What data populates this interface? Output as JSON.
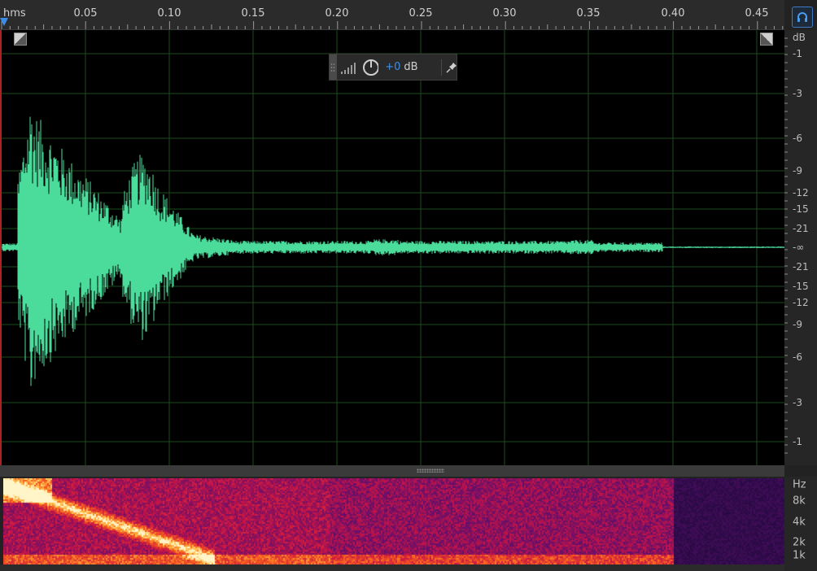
{
  "ruler": {
    "units": "hms",
    "labels": [
      "0.05",
      "0.10",
      "0.15",
      "0.20",
      "0.25",
      "0.30",
      "0.35",
      "0.40",
      "0.45"
    ]
  },
  "hud": {
    "gain_value": "+0",
    "gain_unit": "dB",
    "icons": [
      "volume-bars-icon",
      "power-knob-icon",
      "pin-icon"
    ]
  },
  "db_scale": {
    "unit": "dB",
    "labels": [
      "-1",
      "-3",
      "-6",
      "-9",
      "-12",
      "-15",
      "-21",
      "-∞",
      "-21",
      "-15",
      "-12",
      "-9",
      "-6",
      "-3",
      "-1"
    ]
  },
  "hz_scale": {
    "unit": "Hz",
    "labels": [
      "8k",
      "4k",
      "2k",
      "1k"
    ]
  },
  "colors": {
    "waveform": "#4bdc9c",
    "grid": "#1d4a1d",
    "accent": "#3d8fe8",
    "background": "#000000"
  }
}
